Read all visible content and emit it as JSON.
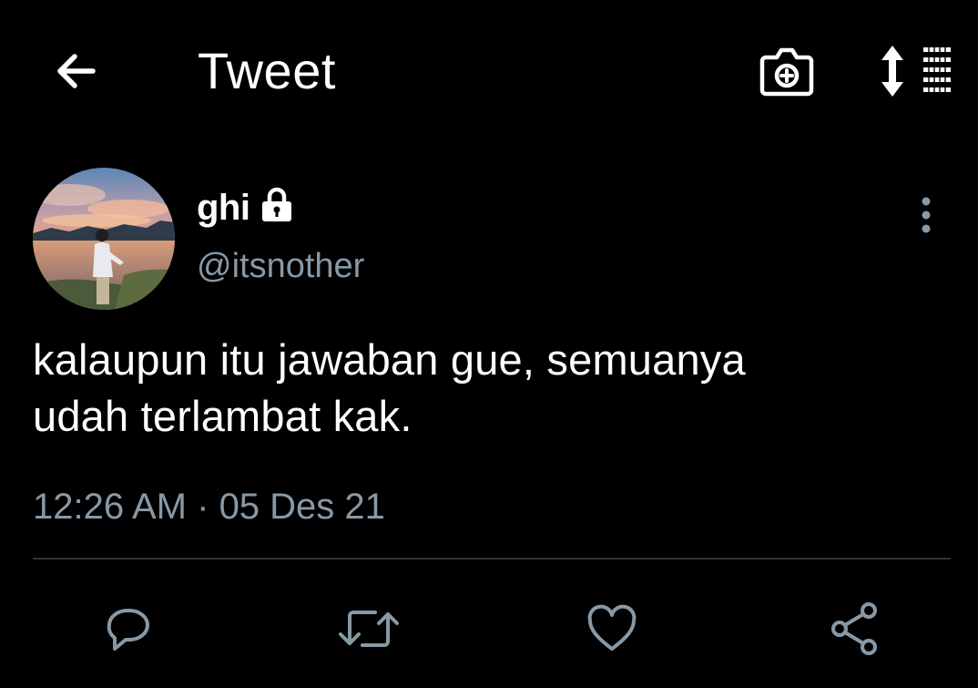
{
  "header": {
    "title": "Tweet",
    "back_icon": "arrow-left-icon",
    "camera_icon": "camera-plus-icon",
    "sort_icon": "sort-list-icon"
  },
  "tweet": {
    "author": {
      "display_name": "ghi",
      "handle": "@itsnother",
      "protected_icon": "lock-icon"
    },
    "text_line1": "kalaupun itu jawaban gue, semuanya",
    "text_line2": "udah terlambat kak.",
    "time": "12:26 AM",
    "separator": " · ",
    "date": "05 Des 21"
  },
  "actions": [
    {
      "icon": "reply-icon"
    },
    {
      "icon": "retweet-icon"
    },
    {
      "icon": "heart-icon"
    },
    {
      "icon": "share-icon"
    }
  ],
  "colors": {
    "background": "#000000",
    "text": "#ffffff",
    "muted": "#8899a6",
    "divider": "#2f3336"
  }
}
